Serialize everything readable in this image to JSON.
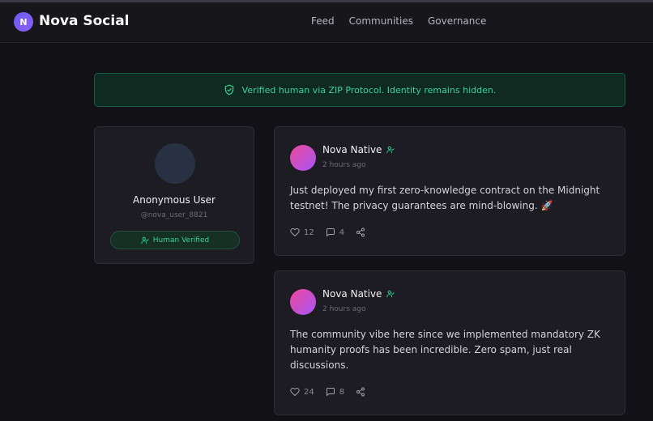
{
  "app": {
    "logo_letter": "N",
    "name": "Nova Social"
  },
  "nav": {
    "items": [
      {
        "label": "Feed"
      },
      {
        "label": "Communities"
      },
      {
        "label": "Governance"
      }
    ]
  },
  "banner": {
    "text": "Verified human via ZIP Protocol. Identity remains hidden.",
    "icon": "shield-check-icon"
  },
  "profile": {
    "name": "Anonymous User",
    "handle": "@nova_user_8821",
    "badge": "Human Verified"
  },
  "posts": [
    {
      "author": "Nova Native",
      "time": "2 hours ago",
      "body": "Just deployed my first zero-knowledge contract on the Midnight testnet! The privacy guarantees are mind-blowing. 🚀",
      "likes": "12",
      "comments": "4"
    },
    {
      "author": "Nova Native",
      "time": "2 hours ago",
      "body": "The community vibe here since we implemented mandatory ZK humanity proofs has been incredible. Zero spam, just real discussions.",
      "likes": "24",
      "comments": "8"
    }
  ],
  "colors": {
    "background": "#121216",
    "card": "#1c1c22",
    "accent_green": "#34d399",
    "brand_purple": "#7c5cf6"
  }
}
